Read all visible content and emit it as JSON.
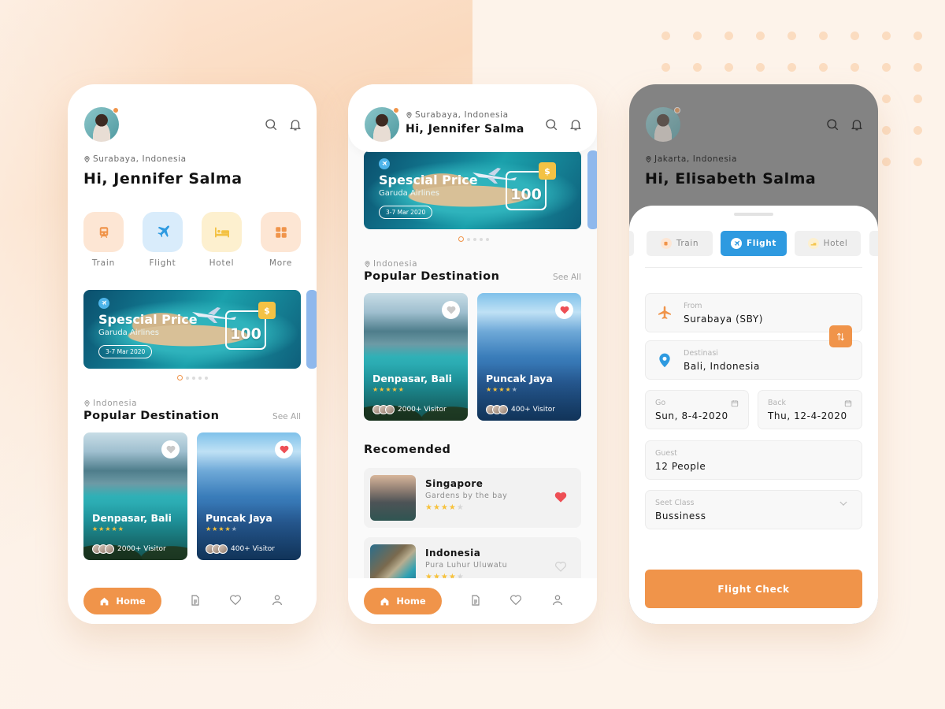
{
  "colors": {
    "accent_orange": "#f0944a",
    "accent_blue": "#2e9ae0",
    "star_yellow": "#f7c23c",
    "heart_red": "#ee4f55"
  },
  "screen1": {
    "location": "Surabaya, Indonesia",
    "greeting": "Hi, Jennifer Salma",
    "categories": [
      {
        "label": "Train",
        "icon": "train-icon"
      },
      {
        "label": "Flight",
        "icon": "airplane-icon"
      },
      {
        "label": "Hotel",
        "icon": "bed-icon"
      },
      {
        "label": "More",
        "icon": "grid-icon"
      }
    ],
    "banner": {
      "title": "Spescial Price",
      "airline": "Garuda Airlines",
      "date": "3-7 Mar 2020",
      "currency": "$",
      "price": "100"
    },
    "carousel": {
      "active_index": 0,
      "count": 5
    },
    "section": {
      "location": "Indonesia",
      "title": "Popular Destination",
      "see_all": "See All"
    },
    "destinations": [
      {
        "name": "Denpasar, Bali",
        "rating": 5,
        "visitors": "2000+ Visitor",
        "favorited": false
      },
      {
        "name": "Puncak Jaya",
        "rating": 4,
        "visitors": "400+ Visitor",
        "favorited": true
      }
    ],
    "nav": {
      "home_label": "Home"
    }
  },
  "screen2": {
    "location": "Surabaya, Indonesia",
    "greeting": "Hi, Jennifer Salma",
    "banner": {
      "title": "Spescial Price",
      "airline": "Garuda Airlines",
      "date": "3-7 Mar 2020",
      "currency": "$",
      "price": "100"
    },
    "carousel": {
      "active_index": 0,
      "count": 5
    },
    "section": {
      "location": "Indonesia",
      "title": "Popular Destination",
      "see_all": "See All"
    },
    "destinations": [
      {
        "name": "Denpasar, Bali",
        "rating": 5,
        "visitors": "2000+ Visitor",
        "favorited": false
      },
      {
        "name": "Puncak Jaya",
        "rating": 4,
        "visitors": "400+ Visitor",
        "favorited": true
      }
    ],
    "recommended_title": "Recomended",
    "recommended": [
      {
        "title": "Singapore",
        "subtitle": "Gardens by the bay",
        "rating": 4,
        "favorited": true
      },
      {
        "title": "Indonesia",
        "subtitle": "Pura Luhur Uluwatu",
        "rating": 4,
        "favorited": false
      }
    ],
    "nav": {
      "home_label": "Home"
    }
  },
  "screen3": {
    "location": "Jakarta, Indonesia",
    "greeting": "Hi, Elisabeth Salma",
    "tabs": [
      {
        "label": "Train",
        "active": false
      },
      {
        "label": "Flight",
        "active": true
      },
      {
        "label": "Hotel",
        "active": false
      }
    ],
    "form": {
      "from_label": "From",
      "from_value": "Surabaya (SBY)",
      "dest_label": "Destinasi",
      "dest_value": "Bali, Indonesia",
      "go_label": "Go",
      "go_value": "Sun, 8-4-2020",
      "back_label": "Back",
      "back_value": "Thu, 12-4-2020",
      "guest_label": "Guest",
      "guest_value": "12 People",
      "class_label": "Seet Class",
      "class_value": "Bussiness"
    },
    "cta": "Flight Check"
  }
}
